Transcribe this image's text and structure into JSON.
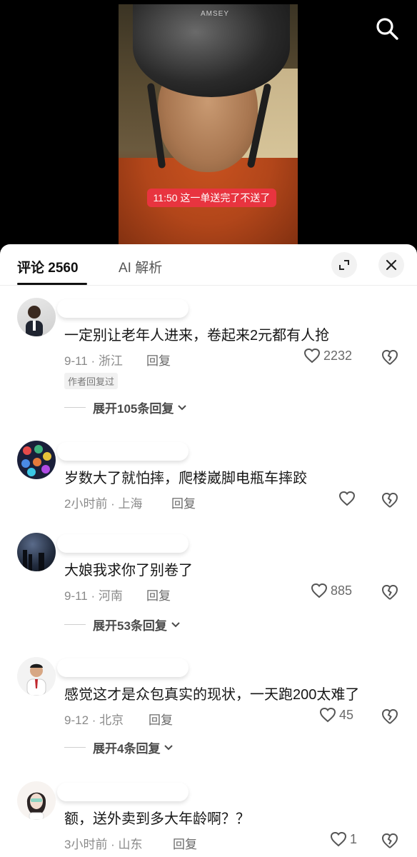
{
  "video": {
    "helmet_brand": "AMSEY",
    "caption": "11:50 这一单送完了不送了"
  },
  "sheet": {
    "tab_comments": "评论 2560",
    "tab_ai": "AI 解析",
    "expand_icon": "expand-icon",
    "close_icon": "close-icon"
  },
  "comments": [
    {
      "text": "一定别让老年人进来，卷起来2元都有人抢",
      "meta": "9-11 · 浙江",
      "reply": "回复",
      "likes": "2232",
      "badge": "作者回复过",
      "expand": "展开105条回复"
    },
    {
      "text": "岁数大了就怕摔，爬楼崴脚电瓶车摔跤",
      "meta": "2小时前 · 上海",
      "reply": "回复",
      "likes": ""
    },
    {
      "text": "大娘我求你了别卷了",
      "meta": "9-11 · 河南",
      "reply": "回复",
      "likes": "885",
      "expand": "展开53条回复"
    },
    {
      "text": "感觉这才是众包真实的现状，一天跑200太难了",
      "meta": "9-12 · 北京",
      "reply": "回复",
      "likes": "45",
      "expand": "展开4条回复"
    },
    {
      "text": "额，送外卖到多大年龄啊？？",
      "meta": "3小时前 · 山东",
      "reply": "回复",
      "likes": "1"
    }
  ]
}
